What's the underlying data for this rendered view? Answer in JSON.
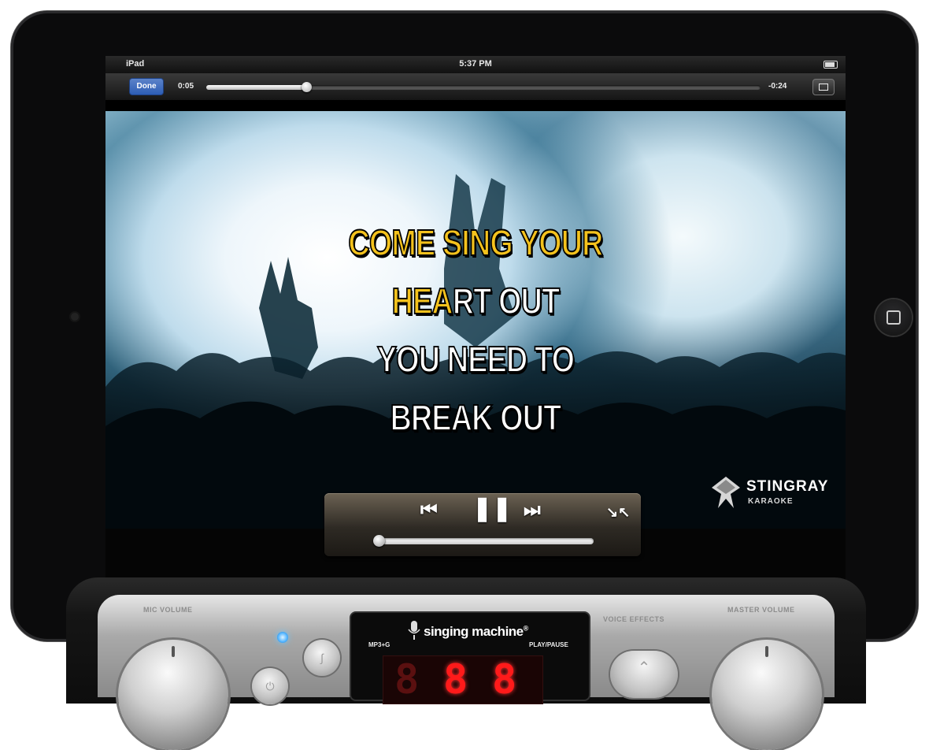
{
  "status_bar": {
    "carrier": "iPad",
    "time": "5:37 PM"
  },
  "player": {
    "done_label": "Done",
    "elapsed": "0:05",
    "remaining": "-0:24",
    "progress_fraction": 0.18,
    "volume_fraction": 0.0
  },
  "lyrics": {
    "line1_sung": "COME SING YOUR",
    "line1_rest": "",
    "line2_sung": "HEA",
    "line2_rest": "RT OUT",
    "line3": "YOU NEED TO",
    "line4": "BREAK OUT"
  },
  "watermark": {
    "name": "STINGRAY",
    "sub": "KARAOKE"
  },
  "controls": {
    "prev_icon": "skip-back-icon",
    "pause_icon": "pause-icon",
    "next_icon": "skip-forward-icon",
    "shrink_icon": "exit-fullscreen-icon"
  },
  "machine": {
    "brand": "singing machine",
    "brand_mark": "®",
    "mp3_label": "MP3+G",
    "play_label": "PLAY/PAUSE",
    "mic_volume_label": "MIC VOLUME",
    "voice_effects_label": "VOICE EFFECTS",
    "master_volume_label": "MASTER VOLUME",
    "led_color": "#4db2ff",
    "display_color": "#ff1a1a"
  },
  "colors": {
    "sung_lyric": "#f4c21d",
    "unsung_lyric": "#ffffff",
    "done_button": "#2d5db5"
  }
}
